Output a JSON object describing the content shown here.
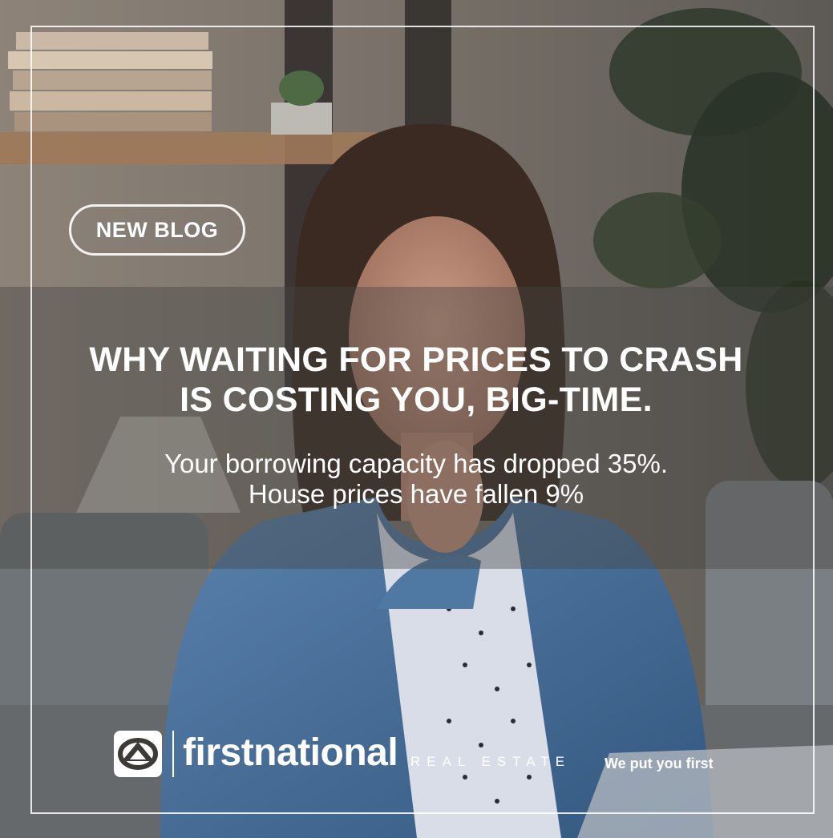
{
  "badge": {
    "label": "NEW BLOG"
  },
  "headline": {
    "line1": "WHY WAITING FOR PRICES TO CRASH",
    "line2": "IS COSTING YOU, BIG-TIME."
  },
  "subheadline": {
    "line1": "Your borrowing capacity has dropped 35%.",
    "line2": "House prices have fallen 9%"
  },
  "brand": {
    "name": "firstnational",
    "suffix": "REAL ESTATE",
    "tagline": "We put you first",
    "logo_icon": "first-national-logo-icon"
  },
  "photo": {
    "icon": "woman-on-sofa-photo"
  }
}
